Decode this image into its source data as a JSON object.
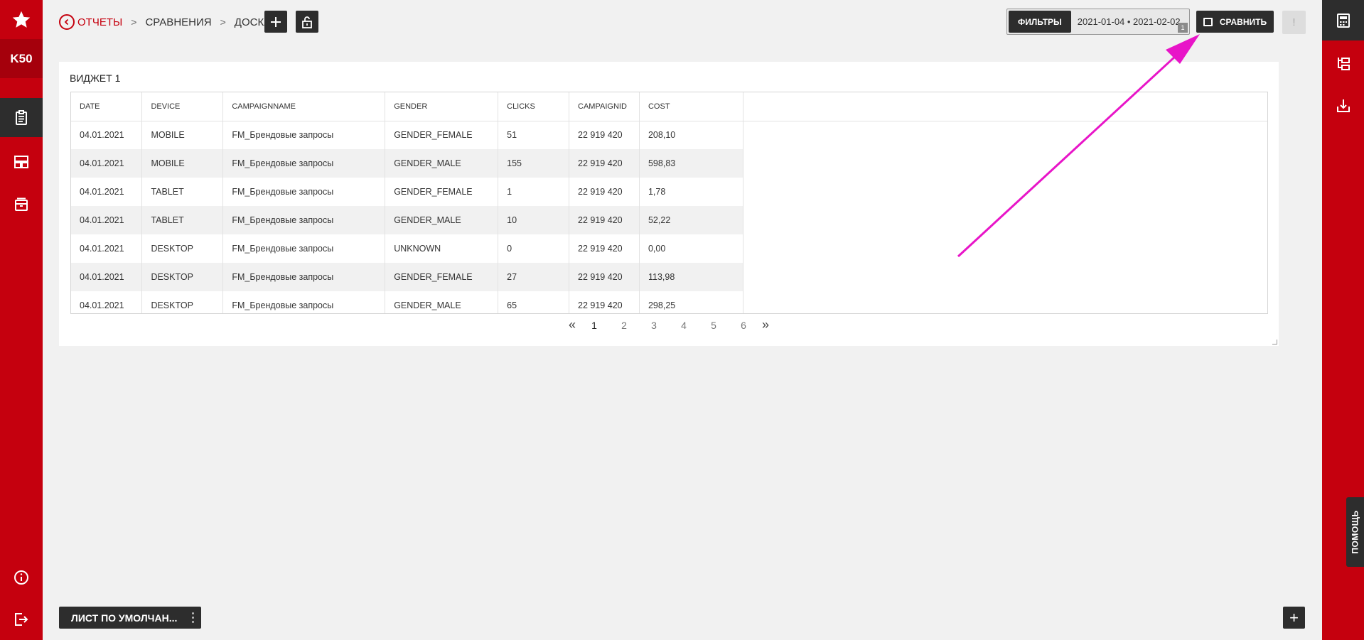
{
  "left_sidebar": {
    "brand": "K50",
    "items": [
      {
        "name": "favorites",
        "icon": "star-icon"
      },
      {
        "name": "reports",
        "icon": "clipboard-icon"
      },
      {
        "name": "dashboards",
        "icon": "layout-icon"
      },
      {
        "name": "archive",
        "icon": "archive-icon"
      },
      {
        "name": "info",
        "icon": "info-icon"
      },
      {
        "name": "logout",
        "icon": "logout-icon"
      }
    ]
  },
  "breadcrumb": {
    "items": [
      "ОТЧЕТЫ",
      "СРАВНЕНИЯ",
      "ДОСКА"
    ]
  },
  "toolbar": {
    "filters_label": "ФИЛЬТРЫ",
    "date_range": "2021-01-04 • 2021-02-02",
    "filter_count": "1",
    "compare_label": "СРАВНИТЬ",
    "warning_label": "!"
  },
  "widget": {
    "title": "ВИДЖЕТ 1",
    "columns": [
      "DATE",
      "DEVICE",
      "CAMPAIGNNAME",
      "GENDER",
      "CLICKS",
      "CAMPAIGNID",
      "COST"
    ],
    "rows": [
      [
        "04.01.2021",
        "MOBILE",
        "FM_Брендовые запросы",
        "GENDER_FEMALE",
        "51",
        "22 919 420",
        "208,10"
      ],
      [
        "04.01.2021",
        "MOBILE",
        "FM_Брендовые запросы",
        "GENDER_MALE",
        "155",
        "22 919 420",
        "598,83"
      ],
      [
        "04.01.2021",
        "TABLET",
        "FM_Брендовые запросы",
        "GENDER_FEMALE",
        "1",
        "22 919 420",
        "1,78"
      ],
      [
        "04.01.2021",
        "TABLET",
        "FM_Брендовые запросы",
        "GENDER_MALE",
        "10",
        "22 919 420",
        "52,22"
      ],
      [
        "04.01.2021",
        "DESKTOP",
        "FM_Брендовые запросы",
        "UNKNOWN",
        "0",
        "22 919 420",
        "0,00"
      ],
      [
        "04.01.2021",
        "DESKTOP",
        "FM_Брендовые запросы",
        "GENDER_FEMALE",
        "27",
        "22 919 420",
        "113,98"
      ],
      [
        "04.01.2021",
        "DESKTOP",
        "FM_Брендовые запросы",
        "GENDER_MALE",
        "65",
        "22 919 420",
        "298,25"
      ]
    ],
    "pagination": {
      "first": "«",
      "last": "»",
      "pages": [
        "1",
        "2",
        "3",
        "4",
        "5",
        "6"
      ],
      "current": "1"
    }
  },
  "bottom": {
    "sheet_tab": "ЛИСТ ПО УМОЛЧАН...",
    "add_sheet": "+"
  },
  "right_sidebar": {
    "items": [
      {
        "name": "calculator",
        "icon": "calculator-icon"
      },
      {
        "name": "structure",
        "icon": "tree-icon"
      },
      {
        "name": "export",
        "icon": "download-icon"
      }
    ],
    "help_label": "ПОМОЩЬ"
  },
  "colors": {
    "brand_red": "#c5000e",
    "dark": "#2d2d2d",
    "annotation_arrow": "#e815c8"
  }
}
